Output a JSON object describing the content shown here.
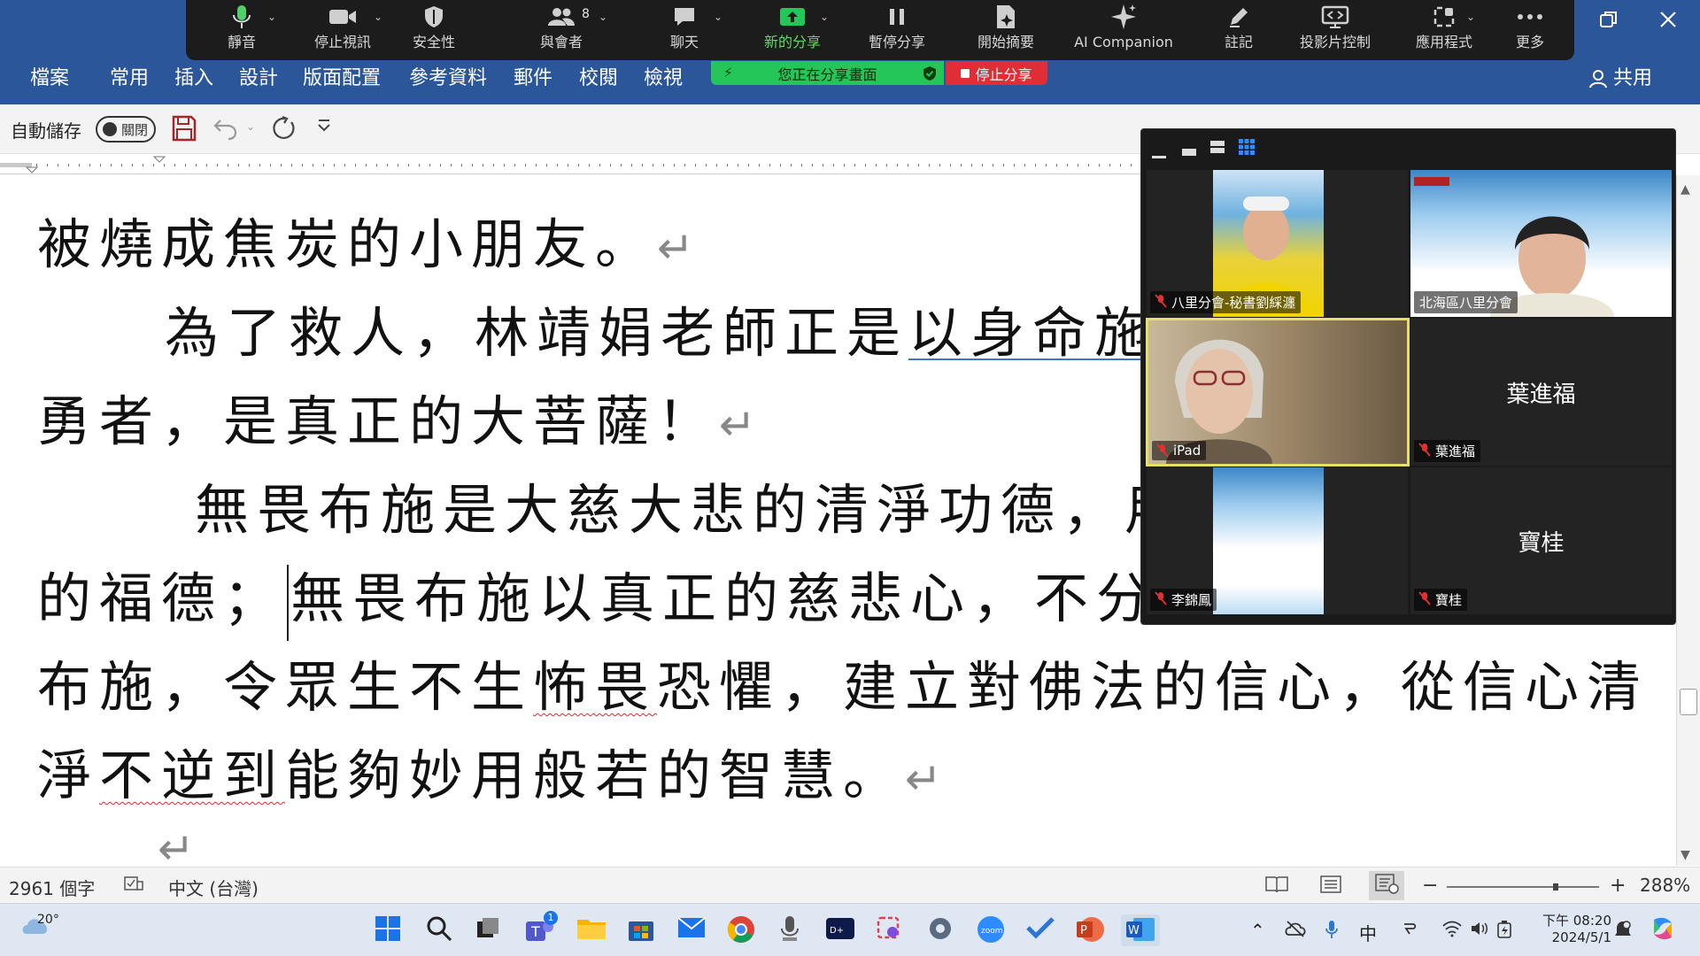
{
  "ribbon": {
    "tabs": [
      "檔案",
      "常用",
      "插入",
      "設計",
      "版面配置",
      "參考資料",
      "郵件",
      "校閱",
      "檢視"
    ],
    "share_label": "共用"
  },
  "zoom_toolbar": {
    "items": [
      {
        "label": "靜音",
        "icon": "microphone-icon"
      },
      {
        "label": "停止視訊",
        "icon": "video-camera-icon"
      },
      {
        "label": "安全性",
        "icon": "shield-icon"
      },
      {
        "label": "與會者",
        "icon": "participants-icon",
        "count": "8"
      },
      {
        "label": "聊天",
        "icon": "chat-icon"
      },
      {
        "label": "新的分享",
        "icon": "share-screen-icon"
      },
      {
        "label": "暫停分享",
        "icon": "pause-icon"
      },
      {
        "label": "開始摘要",
        "icon": "summary-icon"
      },
      {
        "label": "AI Companion",
        "icon": "sparkle-icon"
      },
      {
        "label": "註記",
        "icon": "pen-icon"
      },
      {
        "label": "投影片控制",
        "icon": "slides-icon"
      },
      {
        "label": "應用程式",
        "icon": "apps-icon"
      },
      {
        "label": "更多",
        "icon": "more-icon"
      }
    ],
    "sharing_banner": "您正在分享畫面",
    "stop_share": "停止分享"
  },
  "quick_access": {
    "autosave_label": "自動儲存",
    "autosave_state": "關閉"
  },
  "document": {
    "lines": {
      "l1": "被燒成焦炭的小朋友。",
      "l2a": "為了救人，林靖娟老師正是",
      "l2b": "以身命施",
      "l3": "勇者，是真正的大菩薩！",
      "l4": "無畏布施是大慈大悲的清淨功德，用",
      "l5a": "的福德；",
      "l5b": "無畏布施以真正的慈悲心，不分",
      "l6a": "布施，令眾生不生",
      "l6b": "怖畏",
      "l6c": "恐懼，建立對佛法的信心，從信心清",
      "l7a": "淨",
      "l7b": "不逆到",
      "l7c": "能夠妙用般若的智慧。"
    },
    "paragraph_mark": "↵"
  },
  "gallery": {
    "participants": [
      {
        "name": "八里分會-秘書劉綵瀍"
      },
      {
        "name": "北海區八里分會"
      },
      {
        "name": "iPad"
      },
      {
        "name": "葉進福"
      },
      {
        "name": "李錦鳳"
      },
      {
        "name": "寶桂"
      }
    ]
  },
  "status_bar": {
    "word_count": "2961 個字",
    "language": "中文 (台灣)",
    "zoom": "288%"
  },
  "taskbar": {
    "weather": "20°",
    "teams_badge": "1",
    "ime": "中",
    "time": "下午 08:20",
    "date": "2024/5/1"
  },
  "colors": {
    "ribbon": "#2b579a",
    "sharing_green": "#24c65a",
    "stop_red": "#e02d36",
    "speaker_highlight": "#e6e06a"
  }
}
